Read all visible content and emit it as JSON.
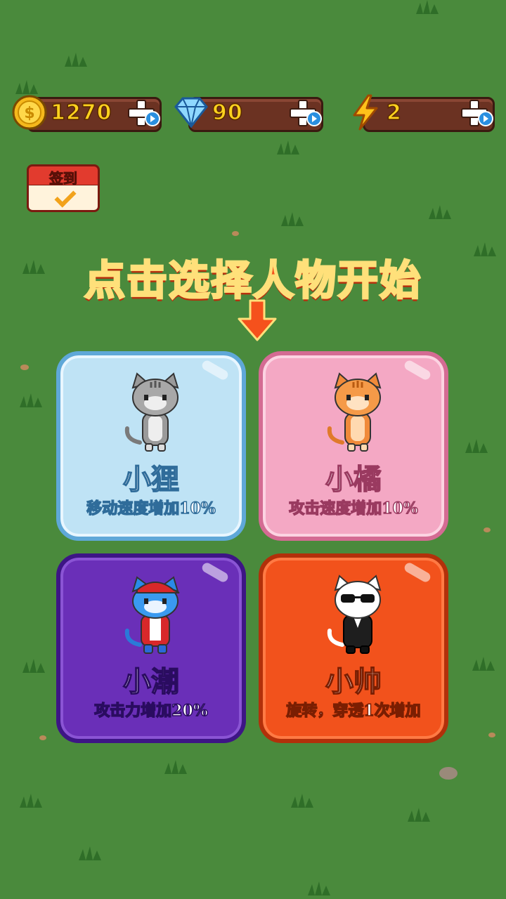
{
  "resources": {
    "coins": {
      "value": "1270",
      "icon": "coin-icon"
    },
    "gems": {
      "value": "90",
      "icon": "diamond-icon"
    },
    "energy": {
      "value": "2",
      "icon": "lightning-icon"
    }
  },
  "checkin": {
    "label": "签到"
  },
  "title": "点击选择人物开始",
  "characters": [
    {
      "name": "小狸",
      "desc": "移动速度增加10%",
      "color": "#bfe3f5",
      "cat": "gray-tabby-cat"
    },
    {
      "name": "小橘",
      "desc": "攻击速度增加10%",
      "color": "#f4a8c4",
      "cat": "orange-cat"
    },
    {
      "name": "小潮",
      "desc": "攻击力增加20%",
      "color": "#6a2fb8",
      "cat": "blue-cat-red-cap"
    },
    {
      "name": "小帅",
      "desc": "旋转，穿透1次增加",
      "color": "#f2521c",
      "cat": "white-cat-sunglasses-suit"
    }
  ]
}
